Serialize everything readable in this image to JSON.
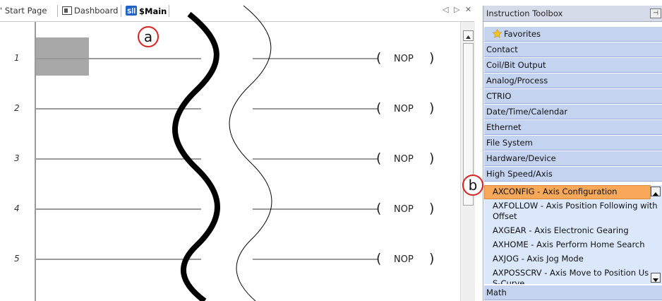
{
  "tabs": [
    {
      "label": "Start Page"
    },
    {
      "label": "Dashboard"
    },
    {
      "label": "$Main"
    }
  ],
  "tab_controls": "◁ ▷ ✕",
  "rungs": [
    {
      "number": "1",
      "instruction": "NOP"
    },
    {
      "number": "2",
      "instruction": "NOP"
    },
    {
      "number": "3",
      "instruction": "NOP"
    },
    {
      "number": "4",
      "instruction": "NOP"
    },
    {
      "number": "5",
      "instruction": "NOP"
    }
  ],
  "toolbox": {
    "title": "Instruction Toolbox",
    "categories": [
      "Favorites",
      "Contact",
      "Coil/Bit Output",
      "Analog/Process",
      "CTRIO",
      "Date/Time/Calendar",
      "Ethernet",
      "File System",
      "Hardware/Device",
      "High Speed/Axis"
    ],
    "items": [
      "AXCONFIG - Axis Configuration",
      "AXFOLLOW - Axis Position Following with",
      "Offset",
      "AXGEAR - Axis Electronic Gearing",
      "AXHOME - Axis Perform Home Search",
      "AXJOG - Axis Jog Mode",
      "AXPOSSCRV - Axis Move to Position Us",
      "S-Curve"
    ],
    "selected_item": "AXCONFIG - Axis Configuration",
    "last_category": "Math"
  },
  "callouts": {
    "a": "a",
    "b": "b"
  },
  "colors": {
    "selected": "#f7a859",
    "category": "#c4d3ef",
    "callout": "#dd2222"
  }
}
